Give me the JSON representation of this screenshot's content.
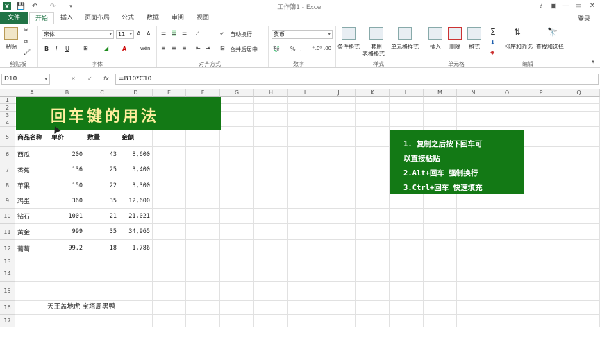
{
  "titlebar": {
    "title": "工作簿1 - Excel",
    "help": "?",
    "min": "—",
    "restore": "▭",
    "close": "✕"
  },
  "tabs": [
    "文件",
    "开始",
    "插入",
    "页面布局",
    "公式",
    "数据",
    "审阅",
    "视图"
  ],
  "login": "登录",
  "ribbon": {
    "clipboard": {
      "paste": "粘贴",
      "label": "剪贴板"
    },
    "font": {
      "name": "宋体",
      "size": "11",
      "label": "字体",
      "bold": "B",
      "italic": "I",
      "underline": "U",
      "grow": "A⁺",
      "shrink": "A⁻",
      "font_color": "A",
      "wen": "wén"
    },
    "align": {
      "wrap": "自动换行",
      "merge": "合并后居中",
      "label": "对齐方式"
    },
    "number": {
      "format": "货币",
      "label": "数字",
      "percent": "%",
      "comma": ",",
      "dec_up": "⁺.0⁰",
      "dec_down": ".00"
    },
    "styles": {
      "cond": "条件格式",
      "table1": "套用",
      "table2": "表格格式",
      "cell": "单元格样式",
      "label": "样式"
    },
    "cells": {
      "insert": "插入",
      "delete": "删除",
      "format": "格式",
      "label": "单元格"
    },
    "editing": {
      "sum": "Σ",
      "sort": "排序和筛选",
      "find": "查找和选择",
      "label": "编辑"
    }
  },
  "formula": {
    "name_box": "D10",
    "cancel": "✕",
    "enter": "✓",
    "fx": "fx",
    "value": "=B10*C10"
  },
  "columns": [
    "A",
    "B",
    "C",
    "D",
    "E",
    "F",
    "G",
    "H",
    "I",
    "J",
    "K",
    "L",
    "M",
    "N",
    "O",
    "P",
    "Q"
  ],
  "rows": [
    "1",
    "2",
    "3",
    "4",
    "5",
    "6",
    "7",
    "8",
    "9",
    "10",
    "11",
    "12",
    "13",
    "14",
    "15",
    "16",
    "17"
  ],
  "banner": "回车键的用法",
  "table": {
    "headers": [
      "商品名称",
      "单价",
      "数量",
      "金额"
    ],
    "rows": [
      [
        "西瓜",
        "200",
        "43",
        "8,600"
      ],
      [
        "香蕉",
        "136",
        "25",
        "3,400"
      ],
      [
        "苹果",
        "150",
        "22",
        "3,300"
      ],
      [
        "鸡蛋",
        "360",
        "35",
        "12,600"
      ],
      [
        "钻石",
        "1001",
        "21",
        "21,021"
      ],
      [
        "黄金",
        "999",
        "35",
        "34,965"
      ],
      [
        "葡萄",
        "99.2",
        "18",
        "1,786"
      ]
    ]
  },
  "note": [
    "1. 复制之后按下回车可",
    "以直接粘贴",
    "2.Alt+回车 强制换行",
    "3.Ctrl+回车 快速填充"
  ],
  "signature": "天王盖地虎 宝塔周黑鸭"
}
